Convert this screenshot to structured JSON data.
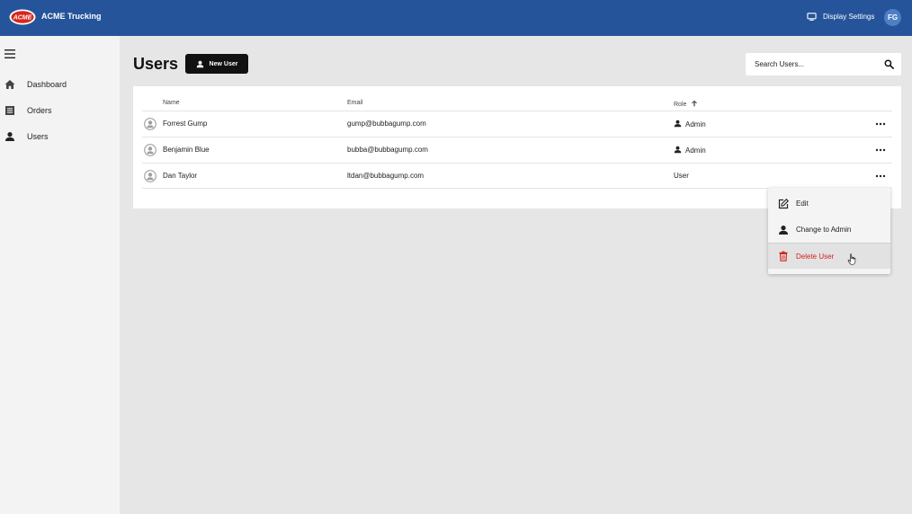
{
  "app": {
    "logo_text": "ACME",
    "title": "ACME Trucking",
    "display_settings_label": "Display Settings",
    "user_initials": "FG",
    "brand_color": "#25549a"
  },
  "sidebar": {
    "items": [
      {
        "label": "Dashboard",
        "icon": "home-icon"
      },
      {
        "label": "Orders",
        "icon": "list-icon"
      },
      {
        "label": "Users",
        "icon": "person-icon"
      }
    ]
  },
  "header": {
    "title": "Users",
    "new_user_label": "New User",
    "search_placeholder": "Search Users..."
  },
  "table": {
    "columns": {
      "name": "Name",
      "email": "Email",
      "role": "Role",
      "sort": "ascending"
    },
    "rows": [
      {
        "name": "Forrest Gump",
        "email": "gump@bubbagump.com",
        "role": "Admin"
      },
      {
        "name": "Benjamin Blue",
        "email": "bubba@bubbagump.com",
        "role": "Admin"
      },
      {
        "name": "Dan Taylor",
        "email": "ltdan@bubbagump.com",
        "role": "User"
      }
    ]
  },
  "menu": {
    "items": [
      {
        "label": "Edit",
        "icon": "edit-icon"
      },
      {
        "label": "Change to Admin",
        "icon": "person-icon"
      },
      {
        "label": "Delete User",
        "icon": "trash-icon",
        "color": "#d42121"
      }
    ]
  }
}
